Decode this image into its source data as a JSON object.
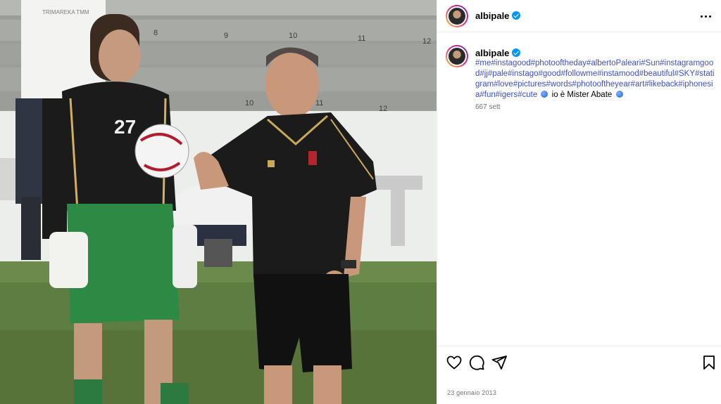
{
  "post": {
    "username": "albipale",
    "caption_hashtags": "#me#instagood#photooftheday#albertoPaleari#Sun#instagramgood#jj#pale#instago#good#followme#instamood#beautiful#SKY#statigram#love#pictures#words#photooftheyear#art#likeback#iphonesia#fun#igers#cute",
    "caption_text": "io è Mister Abate",
    "caption_time": "667 sett",
    "date": "23 gennaio 2013",
    "photo": {
      "jersey_number": "27",
      "stadium_numbers": [
        "8",
        "9",
        "10",
        "11",
        "12"
      ],
      "stadium_numbers_lower": [
        "10",
        "11",
        "12"
      ],
      "banner_text": "TRIMAREKA TMM"
    }
  },
  "icons": {
    "more": "more-options-icon",
    "like": "heart-icon",
    "comment": "comment-icon",
    "share": "share-icon",
    "save": "bookmark-icon",
    "verified": "verified-badge-icon",
    "globe": "globe-emoji-icon"
  },
  "colors": {
    "hashtag": "#3d4fcf",
    "verified": "#0095f6",
    "muted": "#737373"
  }
}
